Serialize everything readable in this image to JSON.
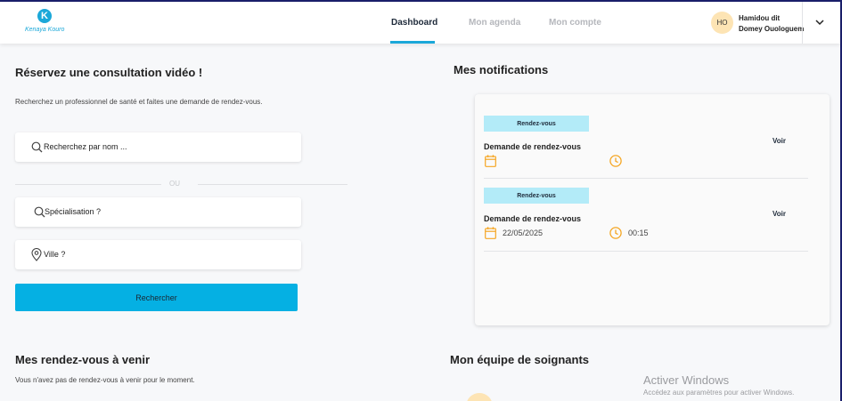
{
  "brand": {
    "logo_letter": "K",
    "name": "Kenaya Kouro"
  },
  "nav": {
    "tabs": [
      {
        "label": "Dashboard"
      },
      {
        "label": "Mon agenda"
      },
      {
        "label": "Mon compte"
      }
    ],
    "active_index": 0
  },
  "user": {
    "initials": "HO",
    "name": "Hamidou dit Domey Ouologuem"
  },
  "booking": {
    "title": "Réservez une consultation vidéo !",
    "subtitle": "Recherchez un professionnel de santé et faites une demande de rendez-vous.",
    "search_placeholder": "Recherchez par nom ...",
    "separator": "OU",
    "speciality_placeholder": "Spécialisation ?",
    "city_placeholder": "Ville ?",
    "button_label": "Rechercher"
  },
  "notifications": {
    "title": "Mes notifications",
    "items": [
      {
        "badge": "Rendez-vous",
        "title": "Demande de rendez-vous",
        "action": "Voir",
        "date": "",
        "time": ""
      },
      {
        "badge": "Rendez-vous",
        "title": "Demande de rendez-vous",
        "action": "Voir",
        "date": "22/05/2025",
        "time": "00:15"
      }
    ]
  },
  "upcoming": {
    "title": "Mes rendez-vous à venir",
    "empty_text": "Vous n'avez pas de rendez-vous à venir pour le moment."
  },
  "team": {
    "title": "Mon équipe de soignants"
  },
  "watermark": {
    "title": "Activer Windows",
    "subtitle": "Accédez aux paramètres pour activer Windows."
  },
  "colors": {
    "accent": "#05b0e3",
    "badge": "#b3ebf8",
    "icon_orange": "#f5a623",
    "avatar_bg": "#fde4b4"
  }
}
